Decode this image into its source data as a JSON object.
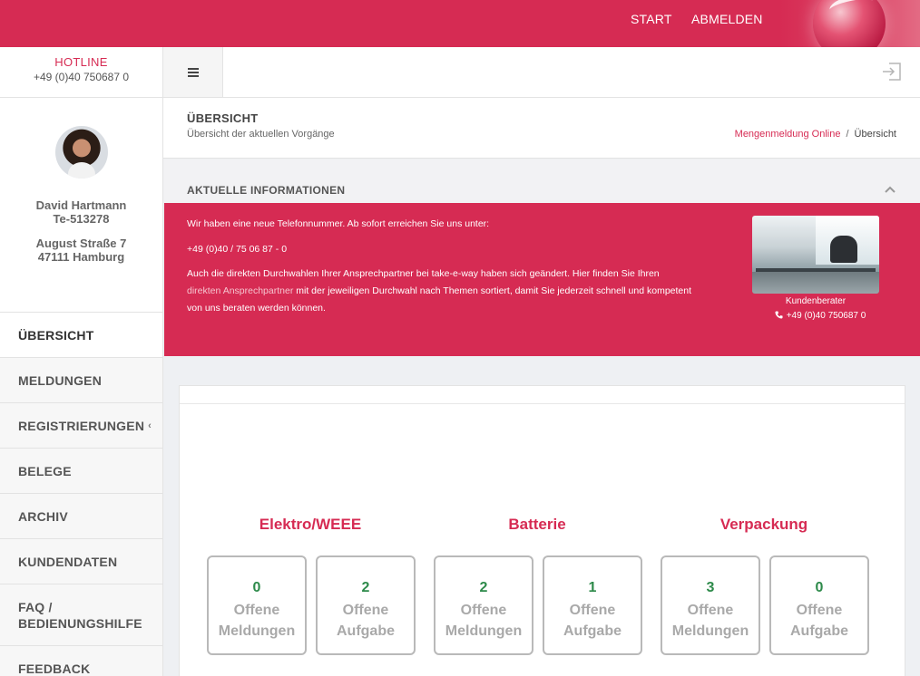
{
  "top_nav": {
    "start": "START",
    "logout": "ABMELDEN"
  },
  "hotline": {
    "title": "HOTLINE",
    "phone": "+49 (0)40 750687 0"
  },
  "profile": {
    "name": "David Hartmann",
    "id": "Te-513278",
    "street": "August Straße 7",
    "city": "47111 Hamburg"
  },
  "sidebar": {
    "items": [
      {
        "label": "ÜBERSICHT"
      },
      {
        "label": "MELDUNGEN"
      },
      {
        "label": "REGISTRIERUNGEN"
      },
      {
        "label": "BELEGE"
      },
      {
        "label": "ARCHIV"
      },
      {
        "label": "KUNDENDATEN"
      },
      {
        "label": "FAQ /"
      },
      {
        "label": "FEEDBACK"
      }
    ],
    "faq_line2": "BEDIENUNGSHILFE"
  },
  "page": {
    "title": "ÜBERSICHT",
    "subtitle": "Übersicht der aktuellen Vorgänge",
    "breadcrumb": {
      "parent": "Mengenmeldung Online",
      "separator": "/",
      "current": "Übersicht"
    }
  },
  "info": {
    "title": "AKTUELLE INFORMATIONEN",
    "line1": "Wir haben eine neue Telefonnummer. Ab sofort erreichen Sie uns unter:",
    "line2": "+49 (0)40 / 75 06 87 - 0",
    "line3_a": "Auch die direkten Durchwahlen Ihrer Ansprechpartner bei take-e-way haben sich geändert. Hier finden Sie Ihren ",
    "line3_link": "direkten Ansprechpartner",
    "line3_b": " mit der jeweiligen Durchwahl nach Themen sortiert, damit Sie jederzeit schnell und kompetent von uns beraten werden können.",
    "caption": "Kundenberater",
    "caption_phone": "+49 (0)40 750687 0"
  },
  "stats": {
    "categories": [
      {
        "title": "Elektro/WEEE",
        "cards": [
          {
            "value": "0",
            "label1": "Offene",
            "label2": "Meldungen"
          },
          {
            "value": "2",
            "label1": "Offene",
            "label2": "Aufgabe"
          }
        ]
      },
      {
        "title": "Batterie",
        "cards": [
          {
            "value": "2",
            "label1": "Offene",
            "label2": "Meldungen"
          },
          {
            "value": "1",
            "label1": "Offene",
            "label2": "Aufgabe"
          }
        ]
      },
      {
        "title": "Verpackung",
        "cards": [
          {
            "value": "3",
            "label1": "Offene",
            "label2": "Meldungen"
          },
          {
            "value": "0",
            "label1": "Offene",
            "label2": "Aufgabe"
          }
        ]
      }
    ]
  },
  "colors": {
    "brand": "#d62b53",
    "success": "#2d8a4a",
    "muted": "#a9a9a9"
  }
}
